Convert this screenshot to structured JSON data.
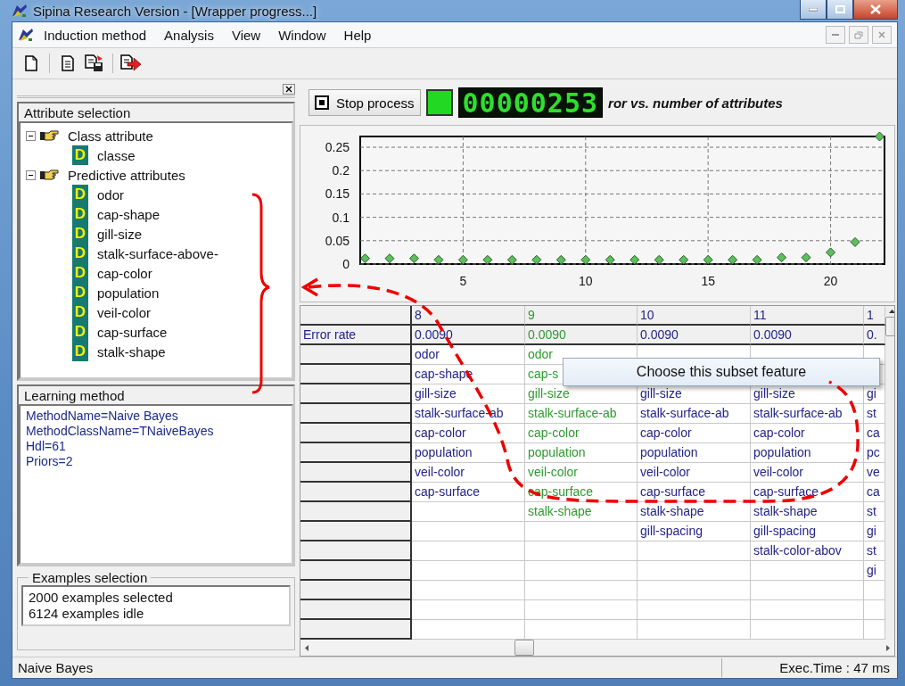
{
  "window": {
    "title": "Sipina Research Version - [Wrapper progress...]"
  },
  "menu": [
    {
      "label": "Induction method"
    },
    {
      "label": "Analysis"
    },
    {
      "label": "View"
    },
    {
      "label": "Window"
    },
    {
      "label": "Help"
    }
  ],
  "attribute_panel": {
    "title": "Attribute selection",
    "groups": [
      {
        "label": "Class attribute",
        "expanded": true,
        "children": [
          {
            "badge": "D",
            "label": "classe"
          }
        ]
      },
      {
        "label": "Predictive attributes",
        "expanded": true,
        "children": [
          {
            "badge": "D",
            "label": "odor"
          },
          {
            "badge": "D",
            "label": "cap-shape"
          },
          {
            "badge": "D",
            "label": "gill-size"
          },
          {
            "badge": "D",
            "label": "stalk-surface-above-"
          },
          {
            "badge": "D",
            "label": "cap-color"
          },
          {
            "badge": "D",
            "label": "population"
          },
          {
            "badge": "D",
            "label": "veil-color"
          },
          {
            "badge": "D",
            "label": "cap-surface"
          },
          {
            "badge": "D",
            "label": "stalk-shape"
          }
        ]
      }
    ]
  },
  "learning_panel": {
    "title": "Learning method",
    "lines": [
      "MethodName=Naive Bayes",
      "MethodClassName=TNaiveBayes",
      "Hdl=61",
      "Priors=2"
    ]
  },
  "examples_panel": {
    "title": "Examples selection",
    "lines": [
      "2000 examples selected",
      "6124 examples idle"
    ]
  },
  "progress": {
    "button": "Stop process",
    "running": true,
    "counter": "00000253",
    "chart_data": {
      "type": "scatter",
      "title": "ror vs. number of attributes",
      "x": [
        1,
        2,
        3,
        4,
        5,
        6,
        7,
        8,
        9,
        10,
        11,
        12,
        13,
        14,
        15,
        16,
        17,
        18,
        19,
        20,
        21,
        22
      ],
      "grid": true,
      "series": [
        {
          "color": "#5cbf5c",
          "values": [
            0.012,
            0.012,
            0.012,
            0.009,
            0.009,
            0.009,
            0.009,
            0.009,
            0.009,
            0.009,
            0.009,
            0.009,
            0.009,
            0.009,
            0.009,
            0.009,
            0.009,
            0.014,
            0.014,
            0.025,
            0.047,
            0.273
          ]
        }
      ],
      "xlim": [
        0.8,
        22.2
      ],
      "ylim": [
        0,
        0.273
      ],
      "xticks": [
        5,
        10,
        15,
        20
      ],
      "yticks": [
        0,
        0.05,
        0.1,
        0.15,
        0.2,
        0.25
      ]
    }
  },
  "grid": {
    "row_label": "Error rate",
    "columns": [
      {
        "header": "8",
        "selected": false,
        "error_rate": "0.0090",
        "cells": [
          "odor",
          "cap-shape",
          "gill-size",
          "stalk-surface-ab",
          "cap-color",
          "population",
          "veil-color",
          "cap-surface"
        ]
      },
      {
        "header": "9",
        "selected": true,
        "error_rate": "0.0090",
        "cells": [
          "odor",
          "cap-s",
          "gill-size",
          "stalk-surface-ab",
          "cap-color",
          "population",
          "veil-color",
          "cap-surface",
          "stalk-shape"
        ]
      },
      {
        "header": "10",
        "selected": false,
        "error_rate": "0.0090",
        "cells": [
          null,
          null,
          "gill-size",
          "stalk-surface-ab",
          "cap-color",
          "population",
          "veil-color",
          "cap-surface",
          "stalk-shape",
          "gill-spacing"
        ]
      },
      {
        "header": "11",
        "selected": false,
        "error_rate": "0.0090",
        "cells": [
          null,
          null,
          "gill-size",
          "stalk-surface-ab",
          "cap-color",
          "population",
          "veil-color",
          "cap-surface",
          "stalk-shape",
          "gill-spacing",
          "stalk-color-abov"
        ]
      },
      {
        "header": "1",
        "selected": false,
        "error_rate": "0.",
        "cells": [
          null,
          null,
          "gi",
          "st",
          "ca",
          "pc",
          "ve",
          "ca",
          "st",
          "gi",
          "st",
          "gi"
        ]
      }
    ]
  },
  "context_menu": {
    "items": [
      "Choose this subset feature"
    ]
  },
  "status_bar": {
    "left": "Naive Bayes",
    "right": "Exec.Time : 47 ms"
  }
}
